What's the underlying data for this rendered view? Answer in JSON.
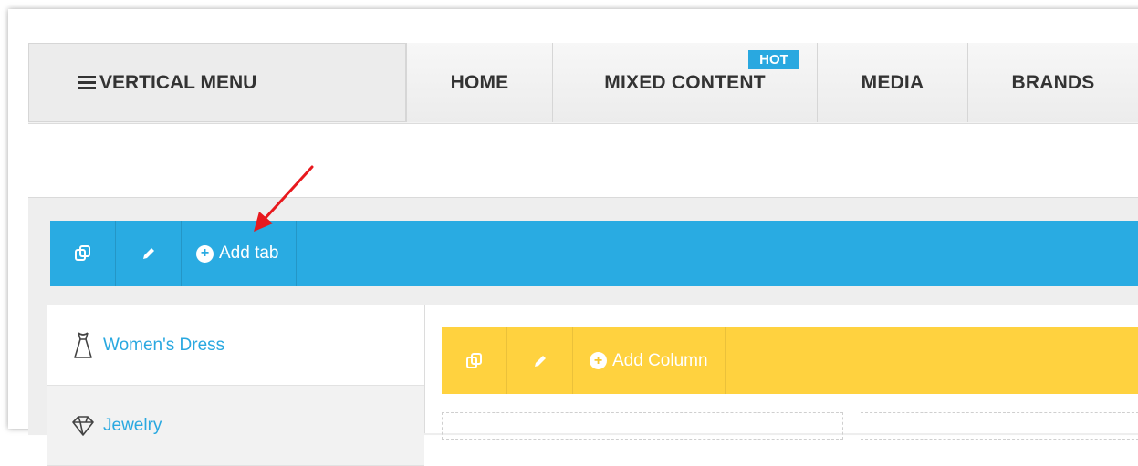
{
  "menu": {
    "vertical_menu_label": "VERTICAL MENU",
    "items": [
      {
        "label": "HOME"
      },
      {
        "label": "MIXED CONTENT",
        "badge": "HOT"
      },
      {
        "label": "MEDIA"
      },
      {
        "label": "BRANDS"
      }
    ]
  },
  "toolbar": {
    "duplicate_icon": "duplicate-icon",
    "edit_icon": "pencil-icon",
    "add_tab_label": "Add tab",
    "color": "#29abe2"
  },
  "tabs": [
    {
      "label": "Women's Dress",
      "icon": "dress-icon"
    },
    {
      "label": "Jewelry",
      "icon": "jewelry-icon"
    }
  ],
  "column_toolbar": {
    "duplicate_icon": "duplicate-icon",
    "edit_icon": "pencil-icon",
    "add_column_label": "Add Column",
    "color": "#ffd23f"
  },
  "colors": {
    "accent_blue": "#29abe2",
    "accent_yellow": "#ffd23f",
    "hot_badge": "#29a8e0",
    "annotation_arrow": "#e8191e"
  }
}
